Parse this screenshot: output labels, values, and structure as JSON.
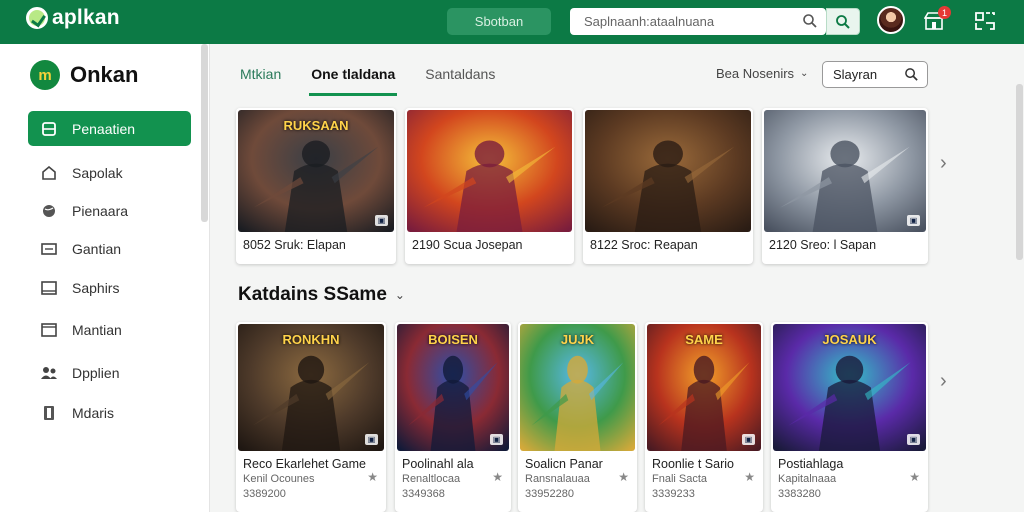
{
  "header": {
    "brand": "aplkan",
    "pill": "Sbotban",
    "search_placeholder": "Saplnaanh:ataalnuana",
    "notifications_count": "1"
  },
  "sidebar": {
    "logo_text": "Onkan",
    "logo_mark": "m",
    "items": [
      {
        "label": "Penaatien",
        "icon": "home-icon",
        "active": true
      },
      {
        "label": "Sapolak",
        "icon": "house-icon",
        "active": false
      },
      {
        "label": "Pienaara",
        "icon": "globe-icon",
        "active": false
      },
      {
        "label": "Gantian",
        "icon": "card-icon",
        "active": false
      },
      {
        "label": "Saphirs",
        "icon": "window-icon",
        "active": false
      },
      {
        "label": "Mantian",
        "icon": "browser-icon",
        "active": false
      },
      {
        "label": "Dpplien",
        "icon": "people-icon",
        "active": false
      },
      {
        "label": "Mdaris",
        "icon": "book-icon",
        "active": false
      }
    ]
  },
  "tabs": [
    {
      "label": "Mtkian",
      "state": "green"
    },
    {
      "label": "One tlaldana",
      "state": "active"
    },
    {
      "label": "Santaldans",
      "state": "plain"
    }
  ],
  "sort_label": "Bea Nosenirs",
  "search2_value": "Slayran",
  "row1": [
    {
      "caption": "8052 Sruk: Elapan",
      "colors": [
        "#3a3f46",
        "#6f4a3a",
        "#1b1d22"
      ],
      "corner": "▣",
      "overlay": "RUKSAAN"
    },
    {
      "caption": "2190 Scua Josepan",
      "colors": [
        "#f5c03a",
        "#d2461e",
        "#7a1d3c"
      ],
      "corner": "",
      "overlay": ""
    },
    {
      "caption": "8122 Sroc: Reapan",
      "colors": [
        "#9a6a3a",
        "#5c3a22",
        "#2a1c14"
      ],
      "corner": "",
      "overlay": ""
    },
    {
      "caption": "2120 Sreo: l Sapan",
      "colors": [
        "#e9ecef",
        "#8e97a3",
        "#4a5260"
      ],
      "corner": "▣",
      "overlay": ""
    }
  ],
  "section_title": "Katdains SSame",
  "row2": [
    {
      "title": "Reco Ekarlehet Game",
      "sub": "Kenil Ocounes",
      "price": "3389200",
      "colors": [
        "#8c6a40",
        "#4e3a2a",
        "#1f1712"
      ],
      "overlay": "RONKHN",
      "corner": "▣"
    },
    {
      "title": "Poolinahl ala",
      "sub": "Renaltlocaa",
      "price": "3349368",
      "colors": [
        "#2e4fa8",
        "#8a2a34",
        "#121a38"
      ],
      "overlay": "BOISEN",
      "corner": "▣"
    },
    {
      "title": "Soalicn Panar",
      "sub": "Ransnalauaa",
      "price": "33952280",
      "colors": [
        "#57b8e8",
        "#3f9a4a",
        "#d4a93a"
      ],
      "overlay": "JUJK",
      "corner": ""
    },
    {
      "title": "Roonlie t Sario",
      "sub": "Fnali Sacta",
      "price": "3339233",
      "colors": [
        "#f2a02a",
        "#b8331e",
        "#4a1a22"
      ],
      "overlay": "SAME",
      "corner": "▣"
    },
    {
      "title": "Postiahlaga",
      "sub": "Kapitalnaaa",
      "price": "3383280",
      "colors": [
        "#34c0c8",
        "#5a2aa8",
        "#1a1a3a"
      ],
      "overlay": "JOSAUK",
      "corner": "▣"
    }
  ]
}
